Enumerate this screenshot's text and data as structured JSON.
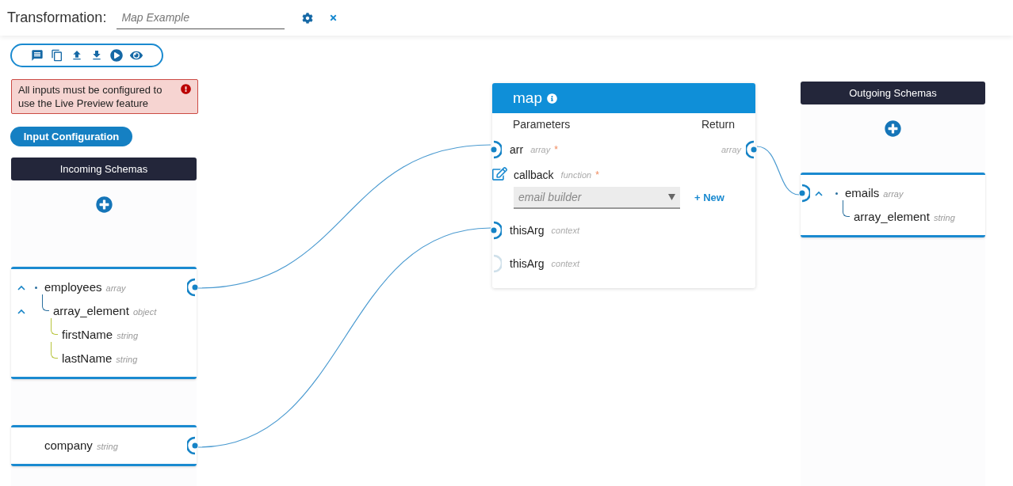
{
  "header": {
    "title": "Transformation:",
    "name_field": {
      "value": "Map Example"
    }
  },
  "alert": {
    "text": "All inputs must be configured to use the Live Preview feature"
  },
  "input_config_button": "Input Configuration",
  "incoming": {
    "title": "Incoming Schemas",
    "schemas": [
      {
        "fields": [
          {
            "name": "employees",
            "type": "array",
            "expanded": true,
            "connected": true,
            "children": [
              {
                "name": "array_element",
                "type": "object",
                "expanded": true,
                "children": [
                  {
                    "name": "firstName",
                    "type": "string"
                  },
                  {
                    "name": "lastName",
                    "type": "string"
                  }
                ]
              }
            ]
          }
        ]
      },
      {
        "fields": [
          {
            "name": "company",
            "type": "string",
            "connected": true
          }
        ]
      }
    ]
  },
  "function_node": {
    "title": "map",
    "parameters_label": "Parameters",
    "return_label": "Return",
    "return_type": "array",
    "params": [
      {
        "kind": "port",
        "name": "arr",
        "type": "array",
        "required_mark": "*",
        "connected": true
      },
      {
        "kind": "callback",
        "name": "callback",
        "type": "function",
        "required_mark": "*",
        "select_value": "email builder",
        "new_label": "+ New"
      },
      {
        "kind": "port",
        "name": "thisArg",
        "type": "context",
        "connected": true
      },
      {
        "kind": "port",
        "name": "thisArg",
        "type": "context",
        "connected": false
      }
    ]
  },
  "outgoing": {
    "title": "Outgoing Schemas",
    "schemas": [
      {
        "fields": [
          {
            "name": "emails",
            "type": "array",
            "expanded": true,
            "connected": true,
            "children": [
              {
                "name": "array_element",
                "type": "string"
              }
            ]
          }
        ]
      }
    ]
  }
}
